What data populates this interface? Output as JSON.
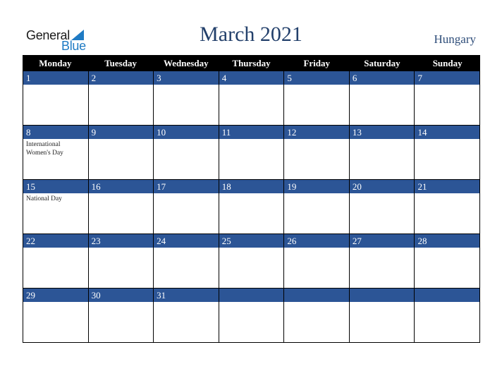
{
  "logo": {
    "word1": "General",
    "word2": "Blue"
  },
  "title": "March 2021",
  "country": "Hungary",
  "colors": {
    "header_bg": "#000000",
    "day_bar": "#2c5596",
    "title": "#23406b",
    "logo_blue": "#1f7bc4"
  },
  "weekdays": [
    "Monday",
    "Tuesday",
    "Wednesday",
    "Thursday",
    "Friday",
    "Saturday",
    "Sunday"
  ],
  "weeks": [
    [
      {
        "day": "1",
        "event": ""
      },
      {
        "day": "2",
        "event": ""
      },
      {
        "day": "3",
        "event": ""
      },
      {
        "day": "4",
        "event": ""
      },
      {
        "day": "5",
        "event": ""
      },
      {
        "day": "6",
        "event": ""
      },
      {
        "day": "7",
        "event": ""
      }
    ],
    [
      {
        "day": "8",
        "event": "International Women's Day"
      },
      {
        "day": "9",
        "event": ""
      },
      {
        "day": "10",
        "event": ""
      },
      {
        "day": "11",
        "event": ""
      },
      {
        "day": "12",
        "event": ""
      },
      {
        "day": "13",
        "event": ""
      },
      {
        "day": "14",
        "event": ""
      }
    ],
    [
      {
        "day": "15",
        "event": "National Day"
      },
      {
        "day": "16",
        "event": ""
      },
      {
        "day": "17",
        "event": ""
      },
      {
        "day": "18",
        "event": ""
      },
      {
        "day": "19",
        "event": ""
      },
      {
        "day": "20",
        "event": ""
      },
      {
        "day": "21",
        "event": ""
      }
    ],
    [
      {
        "day": "22",
        "event": ""
      },
      {
        "day": "23",
        "event": ""
      },
      {
        "day": "24",
        "event": ""
      },
      {
        "day": "25",
        "event": ""
      },
      {
        "day": "26",
        "event": ""
      },
      {
        "day": "27",
        "event": ""
      },
      {
        "day": "28",
        "event": ""
      }
    ],
    [
      {
        "day": "29",
        "event": ""
      },
      {
        "day": "30",
        "event": ""
      },
      {
        "day": "31",
        "event": ""
      },
      {
        "day": "",
        "event": ""
      },
      {
        "day": "",
        "event": ""
      },
      {
        "day": "",
        "event": ""
      },
      {
        "day": "",
        "event": ""
      }
    ]
  ]
}
